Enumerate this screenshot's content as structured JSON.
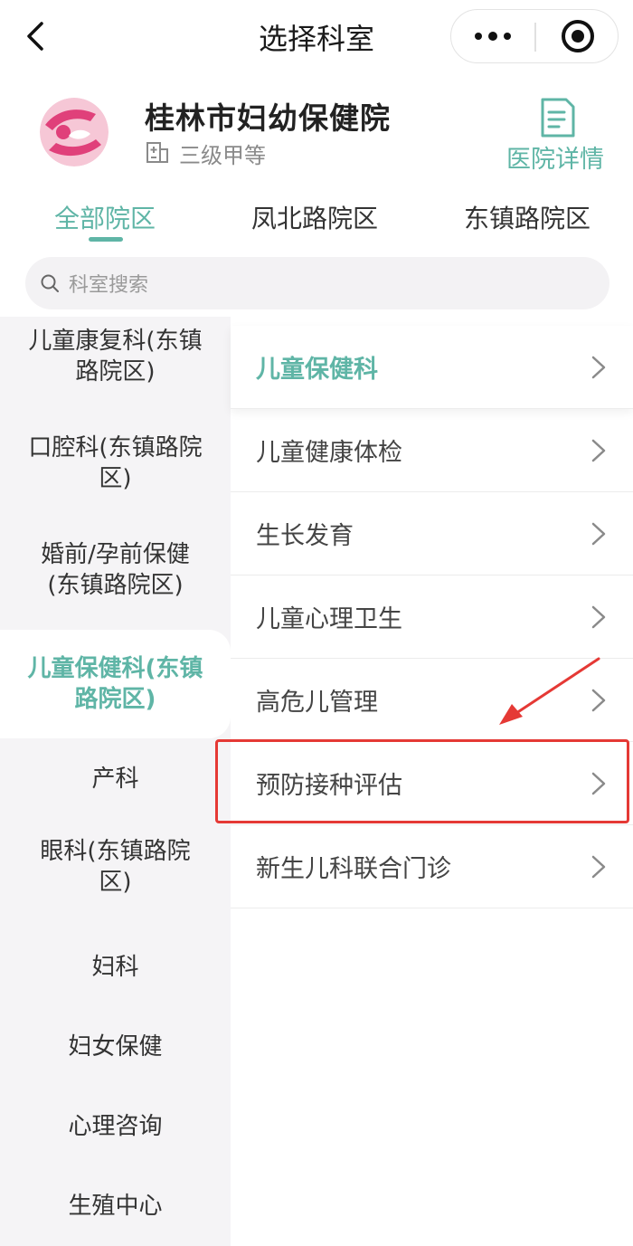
{
  "navbar": {
    "title": "选择科室"
  },
  "hospital": {
    "name": "桂林市妇幼保健院",
    "grade": "三级甲等",
    "detail_label": "医院详情"
  },
  "tabs": [
    {
      "label": "全部院区",
      "active": true
    },
    {
      "label": "凤北路院区",
      "active": false
    },
    {
      "label": "东镇路院区",
      "active": false
    }
  ],
  "search": {
    "placeholder": "科室搜索"
  },
  "departments": [
    {
      "label": "儿童康复科(东镇路院区)"
    },
    {
      "label": "口腔科(东镇路院区)"
    },
    {
      "label": "婚前/孕前保健(东镇路院区)"
    },
    {
      "label": "儿童保健科(东镇路院区)",
      "active": true
    },
    {
      "label": "产科"
    },
    {
      "label": "眼科(东镇路院区)"
    },
    {
      "label": "妇科"
    },
    {
      "label": "妇女保健"
    },
    {
      "label": "心理咨询"
    },
    {
      "label": "生殖中心"
    }
  ],
  "sub_departments": [
    {
      "label": "儿童保健科",
      "active": true
    },
    {
      "label": "儿童健康体检"
    },
    {
      "label": "生长发育"
    },
    {
      "label": "儿童心理卫生"
    },
    {
      "label": "高危儿管理"
    },
    {
      "label": "预防接种评估",
      "highlighted": true
    },
    {
      "label": "新生儿科联合门诊"
    }
  ],
  "colors": {
    "accent": "#5fb5a6",
    "logo_pink": "#e0407a",
    "highlight_red": "#e53935"
  }
}
